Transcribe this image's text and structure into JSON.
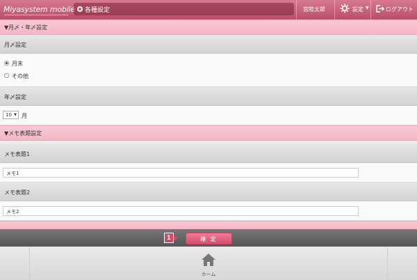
{
  "header": {
    "logo": "Miyasystem mobile",
    "page_title": "各種設定",
    "user_name": "宮陸太郎",
    "settings_label": "設定",
    "logout_label": "ログアウト"
  },
  "sections": {
    "month_year_header": "▼月〆・年〆設定",
    "month_close_label": "月〆設定",
    "month_close_options": [
      "月末",
      "その他"
    ],
    "month_close_selected": "月末",
    "year_close_label": "年〆設定",
    "year_close_month_value": "10",
    "year_close_month_unit": "月",
    "memo_header": "▼メモ表題設定",
    "memo1_label": "メモ表題1",
    "memo1_value": "メモ1",
    "memo2_label": "メモ表題2",
    "memo2_value": "メモ2"
  },
  "footer": {
    "step_badge": "1",
    "confirm_label": "確 定",
    "home_label": "ホーム"
  },
  "colors": {
    "header_pink": "#c35a74",
    "section_pink": "#f6bfcc",
    "confirm_button": "#e45f80"
  }
}
